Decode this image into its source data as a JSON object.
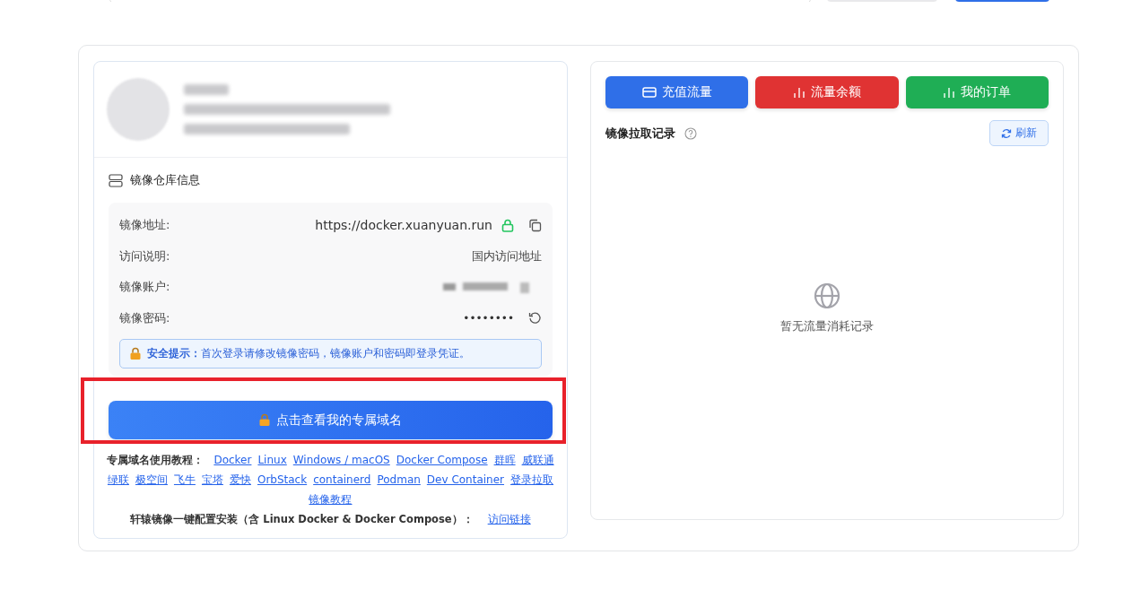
{
  "repo_info": {
    "title": "镜像仓库信息",
    "rows": [
      {
        "kind": "address",
        "label": "镜像地址:",
        "value": "https://docker.xuanyuan.run"
      },
      {
        "kind": "text",
        "label": "访问说明:",
        "value": "国内访问地址"
      },
      {
        "kind": "hidden",
        "label": "镜像账户:"
      },
      {
        "kind": "password",
        "label": "镜像密码:",
        "value": "••••••••"
      }
    ],
    "notice": "**安全提示：**首次登录请修改镜像密码，镜像账户和密码即登录凭证。"
  },
  "domain_button": "点击查看我的专属域名",
  "tutorials": {
    "label": "专属域名使用教程：",
    "links": [
      "Docker",
      "Linux",
      "Windows / macOS",
      "Docker Compose",
      "群晖",
      "威联通",
      "绿联",
      "极空间",
      "飞牛",
      "宝塔",
      "爱快",
      "OrbStack",
      "containerd",
      "Podman",
      "Dev Container",
      "登录拉取",
      "镜像教程"
    ]
  },
  "install": {
    "text": "轩辕镜像一键配置安装（含 Linux Docker & Docker Compose）：",
    "link": "访问链接"
  },
  "actions": [
    {
      "kind": "card",
      "label": "充值流量",
      "color": "#2f6fe8"
    },
    {
      "kind": "chart",
      "label": "流量余额",
      "color": "#e03333"
    },
    {
      "kind": "chart",
      "label": "我的订单",
      "color": "#1fae55"
    }
  ],
  "pull_records": {
    "title": "镜像拉取记录",
    "refresh": "刷新",
    "empty": "暂无流量消耗记录"
  }
}
